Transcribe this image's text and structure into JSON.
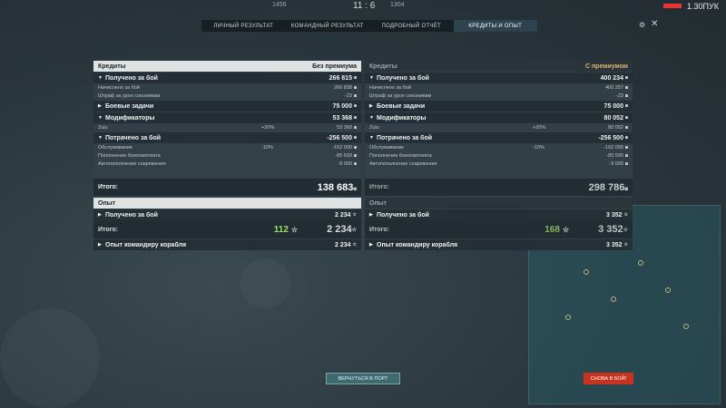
{
  "top": {
    "left_score": "1456",
    "timer": "11 : 6",
    "right_score": "1304",
    "clock": "1.30ПУК"
  },
  "tabs": [
    {
      "label": "Личный результат"
    },
    {
      "label": "Командный результат"
    },
    {
      "label": "Подробный отчёт"
    },
    {
      "label": "Кредиты и опыт"
    }
  ],
  "left": {
    "header": {
      "title": "Кредиты",
      "sub": "Без премиума"
    },
    "received": {
      "label": "Получено за бой",
      "value": "266 815"
    },
    "accrued": {
      "label": "Начислено за бой",
      "value": "266 838"
    },
    "fine": {
      "label": "Штраф за урон союзникам",
      "value": "-23"
    },
    "missions": {
      "label": "Боевые задачи",
      "value": "75 000"
    },
    "modifiers": {
      "label": "Модификаторы",
      "value": "53 368"
    },
    "zulu": {
      "label": "Zulu",
      "pct": "+20%",
      "value": "53 368"
    },
    "spent": {
      "label": "Потрачено за бой",
      "value": "-256 500"
    },
    "service": {
      "label": "Обслуживание",
      "pct": "-10%",
      "value": "-162 000"
    },
    "ammo": {
      "label": "Пополнение боекомплекта",
      "value": "-85 500"
    },
    "supplies": {
      "label": "Автопополнение снаряжения",
      "value": "-9 000"
    },
    "total": {
      "label": "Итого:",
      "value": "138 683"
    },
    "xp_header": {
      "title": "Опыт"
    },
    "xp_received": {
      "label": "Получено за бой",
      "value": "2 234"
    },
    "xp_total": {
      "label": "Итого:",
      "free": "112",
      "value": "2 234"
    },
    "commander": {
      "label": "Опыт командиру корабля",
      "value": "2 234"
    }
  },
  "right": {
    "header": {
      "title": "Кредиты",
      "sub": "С премиумом"
    },
    "received": {
      "label": "Получено за бой",
      "value": "400 234"
    },
    "accrued": {
      "label": "Начислено за бой",
      "value": "400 257"
    },
    "fine": {
      "label": "Штраф за урон союзникам",
      "value": "-23"
    },
    "missions": {
      "label": "Боевые задачи",
      "value": "75 000"
    },
    "modifiers": {
      "label": "Модификаторы",
      "value": "80 052"
    },
    "zulu": {
      "label": "Zulu",
      "pct": "+20%",
      "value": "80 052"
    },
    "spent": {
      "label": "Потрачено за бой",
      "value": "-256 500"
    },
    "service": {
      "label": "Обслуживание",
      "pct": "-10%",
      "value": "-162 000"
    },
    "ammo": {
      "label": "Пополнение боекомплекта",
      "value": "-85 500"
    },
    "supplies": {
      "label": "Автопополнение снаряжения",
      "value": "-9 000"
    },
    "total": {
      "label": "Итого:",
      "value": "298 786"
    },
    "xp_header": {
      "title": "Опыт"
    },
    "xp_received": {
      "label": "Получено за бой",
      "value": "3 352"
    },
    "xp_total": {
      "label": "Итого:",
      "free": "168",
      "value": "3 352"
    },
    "commander": {
      "label": "Опыт командиру корабля",
      "value": "3 352"
    }
  },
  "buttons": {
    "to_port": "Вернуться в порт",
    "battle_again": "Снова в бой!"
  },
  "colors": {
    "accent_red": "#c8321e",
    "free_xp": "#9be064",
    "premium": "#e0b06a"
  }
}
